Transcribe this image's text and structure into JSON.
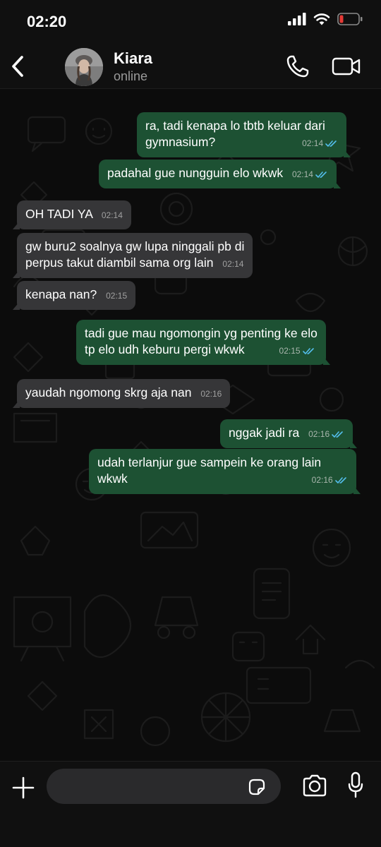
{
  "status_bar": {
    "time": "02:20"
  },
  "contact": {
    "name": "Kiara",
    "status": "online"
  },
  "messages": [
    {
      "dir": "out",
      "lines": [
        "ra, tadi kenapa lo tbtb keluar dari",
        "gymnasium?"
      ],
      "time": "02:14",
      "read": true
    },
    {
      "dir": "out",
      "lines": [
        "padahal gue nungguin elo wkwk"
      ],
      "time": "02:14",
      "read": true
    },
    {
      "dir": "in",
      "lines": [
        "OH TADI YA"
      ],
      "time": "02:14"
    },
    {
      "dir": "in",
      "lines": [
        "gw buru2 soalnya gw lupa ninggali pb di",
        "perpus takut diambil sama org lain"
      ],
      "time": "02:14"
    },
    {
      "dir": "in",
      "lines": [
        "kenapa nan?"
      ],
      "time": "02:15"
    },
    {
      "dir": "out",
      "lines": [
        "tadi gue mau ngomongin yg penting ke elo",
        "tp elo udh keburu pergi wkwk"
      ],
      "time": "02:15",
      "read": true
    },
    {
      "dir": "in",
      "lines": [
        "yaudah ngomong skrg aja nan"
      ],
      "time": "02:16"
    },
    {
      "dir": "out",
      "lines": [
        "nggak jadi ra"
      ],
      "time": "02:16",
      "read": true
    },
    {
      "dir": "out",
      "lines": [
        "udah terlanjur gue sampein ke orang lain",
        "wkwk"
      ],
      "time": "02:16",
      "read": true
    }
  ],
  "input": {
    "value": "",
    "placeholder": ""
  },
  "colors": {
    "outgoing_bubble": "#1d5133",
    "incoming_bubble": "#363638",
    "read_ticks": "#53bdeb",
    "battery_low": "#e53935",
    "chat_background": "#0c0c0c"
  },
  "icons": {
    "back": "chevron-left-icon",
    "call": "phone-icon",
    "video": "video-camera-icon",
    "attach": "plus-icon",
    "sticker": "sticker-icon",
    "camera": "camera-icon",
    "mic": "microphone-icon",
    "read_receipt": "double-check-icon"
  }
}
